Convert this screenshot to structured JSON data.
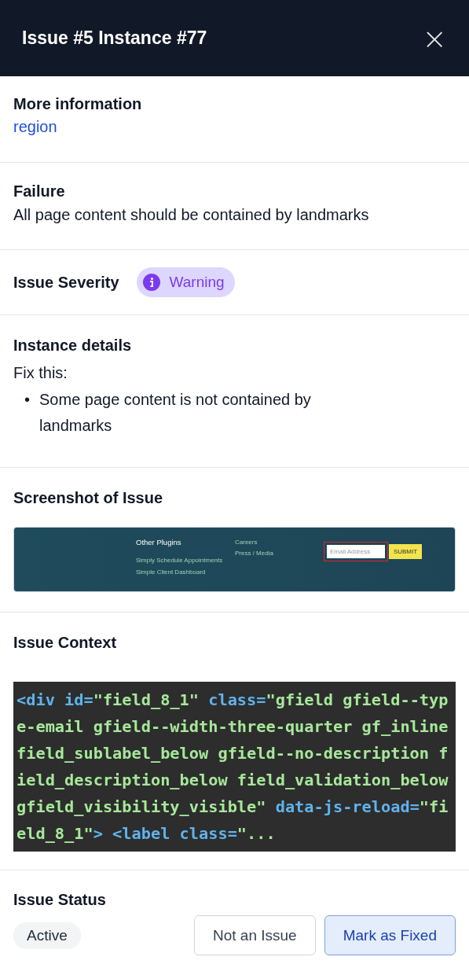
{
  "header": {
    "title": "Issue #5 Instance #77",
    "close_icon": "×"
  },
  "more_information": {
    "heading": "More information",
    "link": "region"
  },
  "failure": {
    "heading": "Failure",
    "text": "All page content should be contained by landmarks"
  },
  "severity": {
    "label": "Issue Severity",
    "badge": "Warning"
  },
  "instance_details": {
    "heading": "Instance details",
    "intro": "Fix this:",
    "items": [
      {
        "bullet": "•",
        "text": "Some page content is not contained by landmarks"
      }
    ]
  },
  "screenshot": {
    "heading": "Screenshot of Issue",
    "image": {
      "columns": [
        {
          "heading": "Other Plugins",
          "links": [
            "Simply Schedule Appointments",
            "Simple Client Dashboard"
          ]
        },
        {
          "links": [
            "Careers",
            "Press / Media"
          ]
        }
      ],
      "email_placeholder": "Email Address",
      "submit": "SUBMIT",
      "highlighted": true
    }
  },
  "context": {
    "heading": "Issue Context",
    "code": [
      {
        "kind": "tag",
        "text": "<div "
      },
      {
        "kind": "attr",
        "text": "id="
      },
      {
        "kind": "value",
        "text": "\"field_8_1\" "
      },
      {
        "kind": "attr",
        "text": "class="
      },
      {
        "kind": "value",
        "text": "\"gfield gfield--type-email gfield--width-three-quarter gf_inline field_sublabel_below gfield--no-description field_description_below field_validation_below gfield_visibility_visible\" "
      },
      {
        "kind": "attr",
        "text": "data-js-reload="
      },
      {
        "kind": "value",
        "text": "\"field_8_1\""
      },
      {
        "kind": "tag",
        "text": "> <label "
      },
      {
        "kind": "attr",
        "text": "class="
      },
      {
        "kind": "value",
        "text": "\"..."
      }
    ]
  },
  "status": {
    "heading": "Issue Status",
    "value": "Active",
    "buttons": [
      {
        "label": "Not an Issue",
        "primary": false
      },
      {
        "label": "Mark as Fixed",
        "primary": true
      }
    ]
  }
}
